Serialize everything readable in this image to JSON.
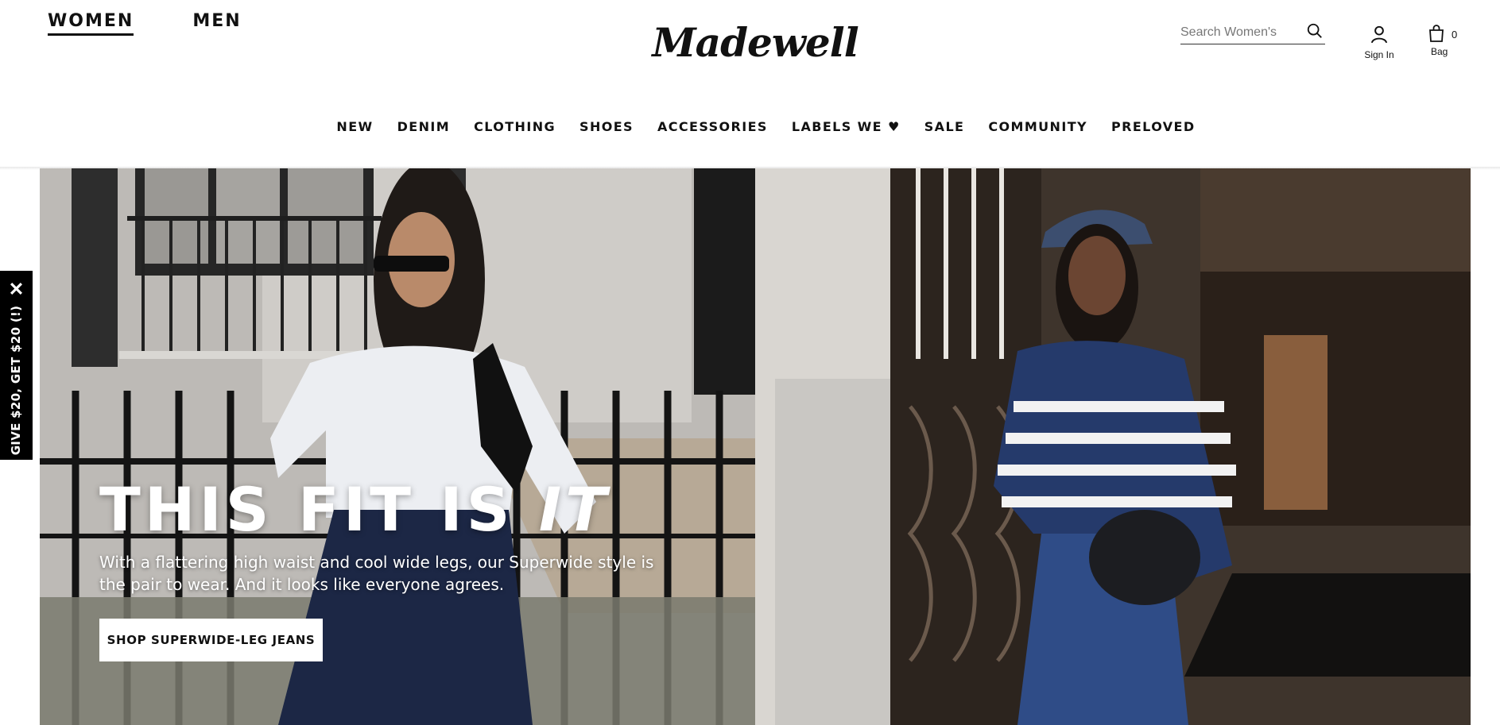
{
  "header": {
    "gender_tabs": [
      {
        "label": "WOMEN",
        "active": true
      },
      {
        "label": "MEN",
        "active": false
      }
    ],
    "logo": "Madewell",
    "search": {
      "placeholder": "Search Women's",
      "value": "",
      "icon": "search-icon"
    },
    "account": {
      "label": "Sign In",
      "icon": "user-icon"
    },
    "bag": {
      "label": "Bag",
      "count": "0",
      "icon": "bag-icon"
    }
  },
  "nav": {
    "items": [
      "NEW",
      "DENIM",
      "CLOTHING",
      "SHOES",
      "ACCESSORIES",
      "LABELS WE ♥",
      "SALE",
      "COMMUNITY",
      "PRELOVED"
    ]
  },
  "hero": {
    "title_main": "THIS FIT IS ",
    "title_emphasis": "IT",
    "body": "With a flattering high waist and cool wide legs, our Superwide style is the pair to wear. And it looks like everyone agrees.",
    "cta_label": "SHOP SUPERWIDE-LEG JEANS",
    "images": [
      "woman in white shirt and sunglasses with black shoulder bag in front of iron fence",
      "woman in navy cap and striped navy sweater holding black bag"
    ]
  },
  "promo": {
    "text": "GIVE $20, GET $20 (!)",
    "close_icon": "close-icon"
  },
  "colors": {
    "text": "#111111",
    "background": "#ffffff",
    "promo_bg": "#000000",
    "sweater_navy": "#253a6b"
  }
}
